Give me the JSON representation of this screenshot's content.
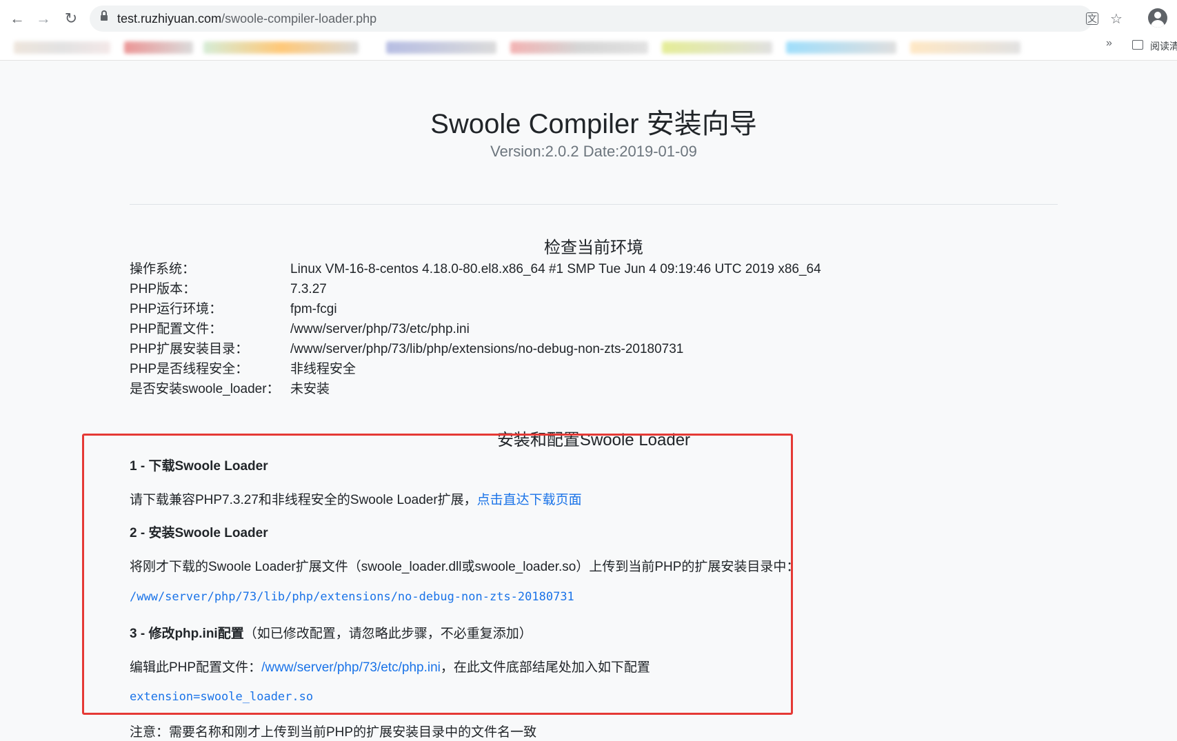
{
  "browser": {
    "url_host": "test.ruzhiyuan.com",
    "url_path": "/swoole-compiler-loader.php",
    "more_label": "»",
    "reading_label": "阅读清"
  },
  "header": {
    "title": "Swoole Compiler 安装向导",
    "version": "Version:2.0.2 Date:2019-01-09"
  },
  "env": {
    "title": "检查当前环境",
    "rows": [
      {
        "label": "操作系统：",
        "value": "Linux VM-16-8-centos 4.18.0-80.el8.x86_64 #1 SMP Tue Jun 4 09:19:46 UTC 2019 x86_64"
      },
      {
        "label": "PHP版本：",
        "value": "7.3.27"
      },
      {
        "label": "PHP运行环境：",
        "value": "fpm-fcgi"
      },
      {
        "label": "PHP配置文件：",
        "value": "/www/server/php/73/etc/php.ini"
      },
      {
        "label": "PHP扩展安装目录：",
        "value": "/www/server/php/73/lib/php/extensions/no-debug-non-zts-20180731"
      },
      {
        "label": "PHP是否线程安全：",
        "value": "非线程安全"
      },
      {
        "label": "是否安装swoole_loader：",
        "value": "未安装"
      }
    ]
  },
  "install": {
    "title": "安装和配置Swoole Loader",
    "step1_heading": "1 - 下载Swoole Loader",
    "step1_text": "请下载兼容PHP7.3.27和非线程安全的Swoole Loader扩展，",
    "step1_link": "点击直达下载页面",
    "step2_heading": "2 - 安装Swoole Loader",
    "step2_text": "将刚才下载的Swoole Loader扩展文件（swoole_loader.dll或swoole_loader.so）上传到当前PHP的扩展安装目录中：",
    "step2_path": "/www/server/php/73/lib/php/extensions/no-debug-non-zts-20180731",
    "step3_heading": "3 - 修改php.ini配置",
    "step3_hint": "（如已修改配置，请忽略此步骤，不必重复添加）",
    "step3_text_pre": "编辑此PHP配置文件：",
    "step3_ini_path": "/www/server/php/73/etc/php.ini",
    "step3_text_post": "，在此文件底部结尾处加入如下配置",
    "step3_config": "extension=swoole_loader.so",
    "note": "注意：需要名称和刚才上传到当前PHP的扩展安装目录中的文件名一致"
  },
  "colors": {
    "link": "#1a73e8",
    "highlight": "#e53935"
  }
}
